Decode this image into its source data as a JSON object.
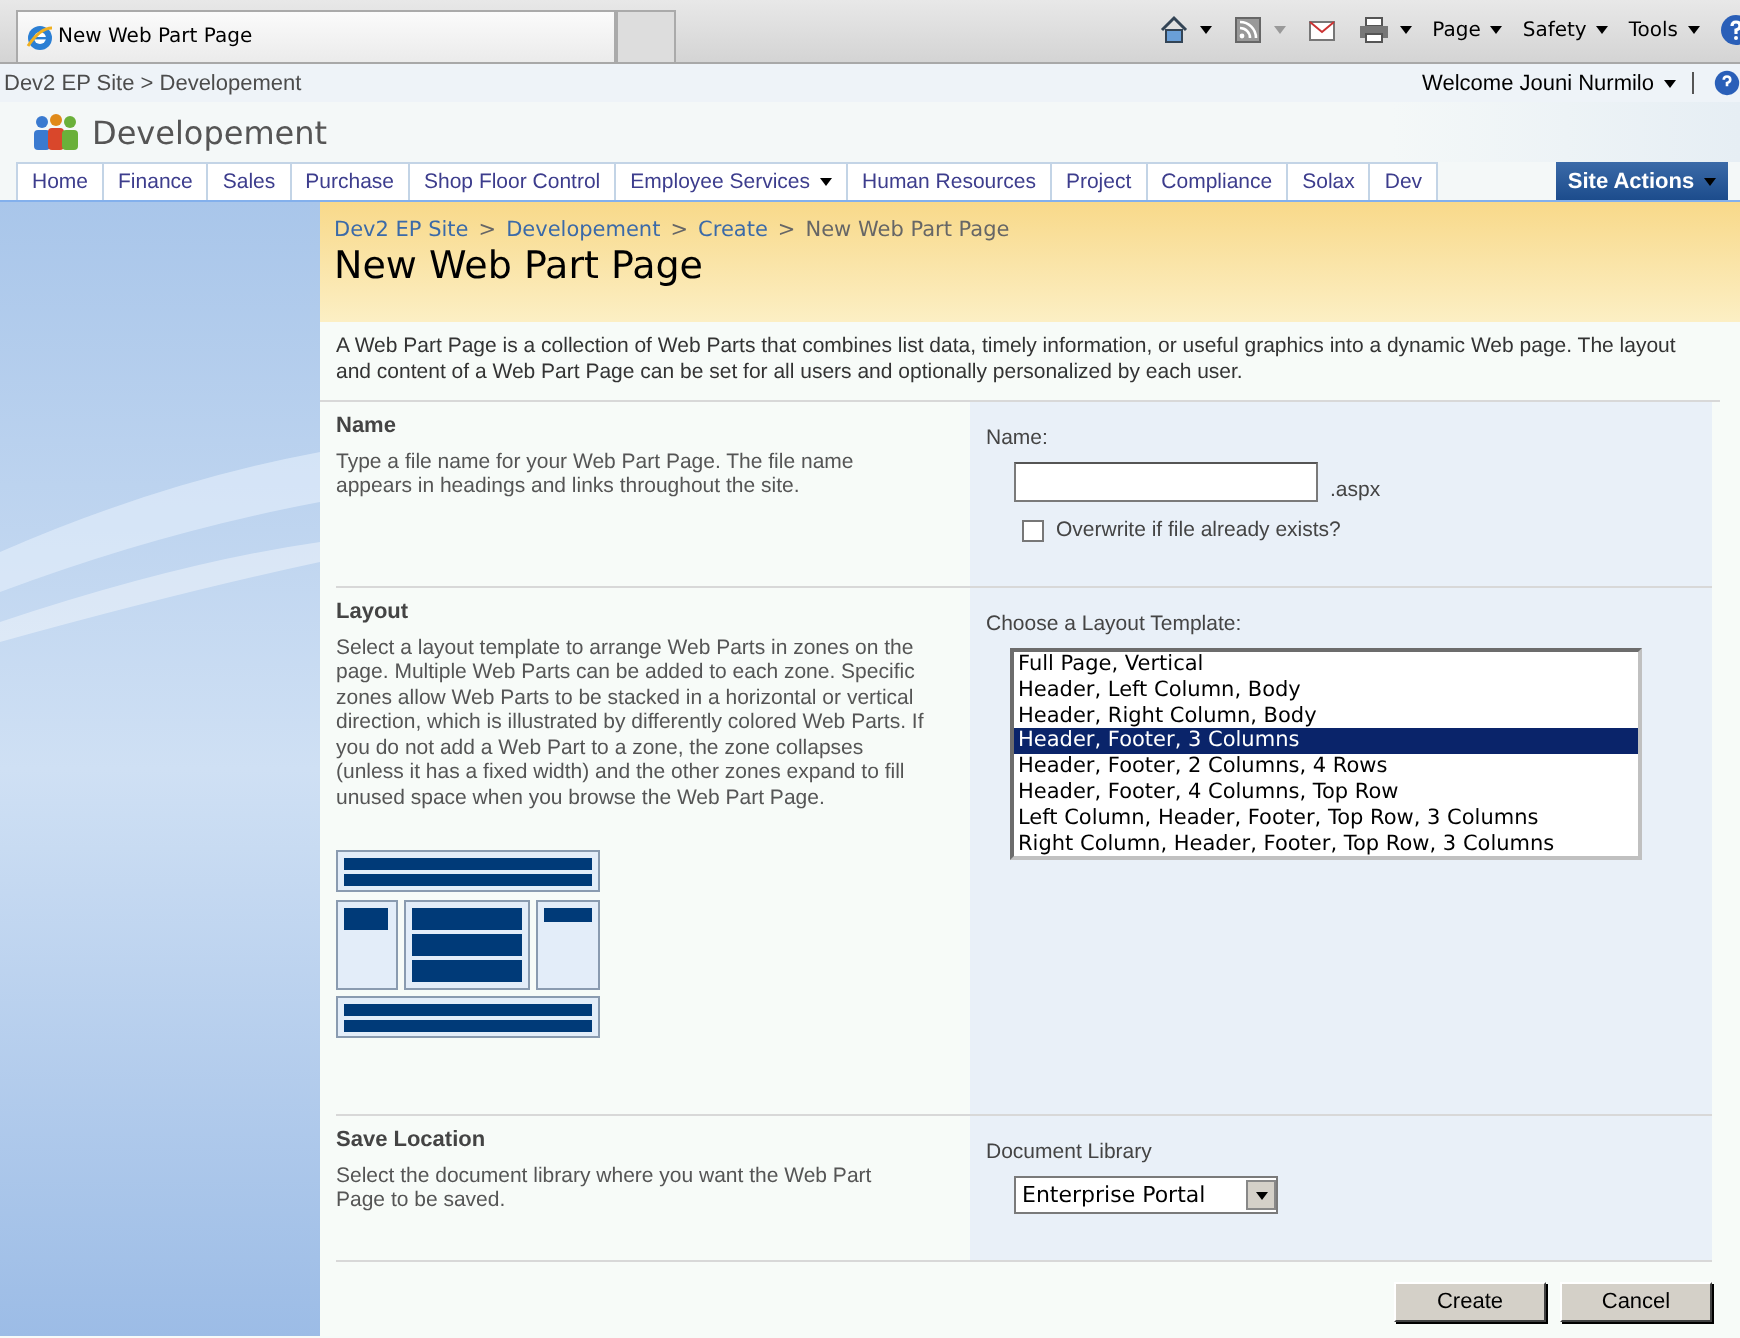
{
  "browser": {
    "tab_title": "New Web Part Page",
    "menus": [
      {
        "label": "Page"
      },
      {
        "label": "Safety"
      },
      {
        "label": "Tools"
      }
    ]
  },
  "site": {
    "breadcrumb": "Dev2 EP Site > Developement",
    "welcome": "Welcome Jouni Nurmilo",
    "title": "Developement"
  },
  "nav": {
    "tabs": [
      {
        "label": "Home",
        "dropdown": false
      },
      {
        "label": "Finance",
        "dropdown": false
      },
      {
        "label": "Sales",
        "dropdown": false
      },
      {
        "label": "Purchase",
        "dropdown": false
      },
      {
        "label": "Shop Floor Control",
        "dropdown": false
      },
      {
        "label": "Employee Services",
        "dropdown": true
      },
      {
        "label": "Human Resources",
        "dropdown": false
      },
      {
        "label": "Project",
        "dropdown": false
      },
      {
        "label": "Compliance",
        "dropdown": false
      },
      {
        "label": "Solax",
        "dropdown": false
      },
      {
        "label": "Dev",
        "dropdown": false
      }
    ],
    "site_actions": "Site Actions"
  },
  "page": {
    "breadcrumb": [
      {
        "label": "Dev2 EP Site",
        "link": true
      },
      {
        "label": "Developement",
        "link": true
      },
      {
        "label": "Create",
        "link": true
      },
      {
        "label": "New Web Part Page",
        "link": false
      }
    ],
    "separator": ">",
    "title": "New Web Part Page",
    "intro": "A Web Part Page is a collection of Web Parts that combines list data, timely information, or useful graphics into a dynamic Web page. The layout and content of a Web Part Page can be set for all users and optionally personalized by each user."
  },
  "sections": [
    {
      "kind": "name",
      "heading": "Name",
      "description": "Type a file name for your Web Part Page.  The file name appears in headings and links throughout the site.",
      "field_label": "Name:",
      "suffix": ".aspx",
      "checkbox": {
        "label": "Overwrite if file already exists?",
        "checked": false
      }
    },
    {
      "kind": "layout",
      "heading": "Layout",
      "description": "Select a layout template to arrange Web Parts in zones on the page. Multiple Web Parts can be added to each zone. Specific zones allow Web Parts to be stacked in a horizontal or vertical direction, which is illustrated by differently colored Web Parts. If you do not add a Web Part to a zone, the zone collapses (unless it has a fixed width) and the other zones expand to fill unused space when you browse the Web Part Page.",
      "field_label": "Choose a Layout Template:",
      "options": [
        {
          "label": "Full Page, Vertical",
          "selected": false
        },
        {
          "label": "Header, Left Column, Body",
          "selected": false
        },
        {
          "label": "Header, Right Column, Body",
          "selected": false
        },
        {
          "label": "Header, Footer, 3 Columns",
          "selected": true
        },
        {
          "label": "Header, Footer, 2 Columns, 4 Rows",
          "selected": false
        },
        {
          "label": "Header, Footer, 4 Columns, Top Row",
          "selected": false
        },
        {
          "label": "Left Column, Header, Footer, Top Row, 3 Columns",
          "selected": false
        },
        {
          "label": "Right Column, Header, Footer, Top Row, 3 Columns",
          "selected": false
        }
      ]
    },
    {
      "kind": "save",
      "heading": "Save Location",
      "description": "Select the document library where you want the Web Part Page to be saved.",
      "field_label": "Document Library",
      "select_value": "Enterprise Portal"
    }
  ],
  "buttons": [
    {
      "label": "Create"
    },
    {
      "label": "Cancel"
    }
  ]
}
